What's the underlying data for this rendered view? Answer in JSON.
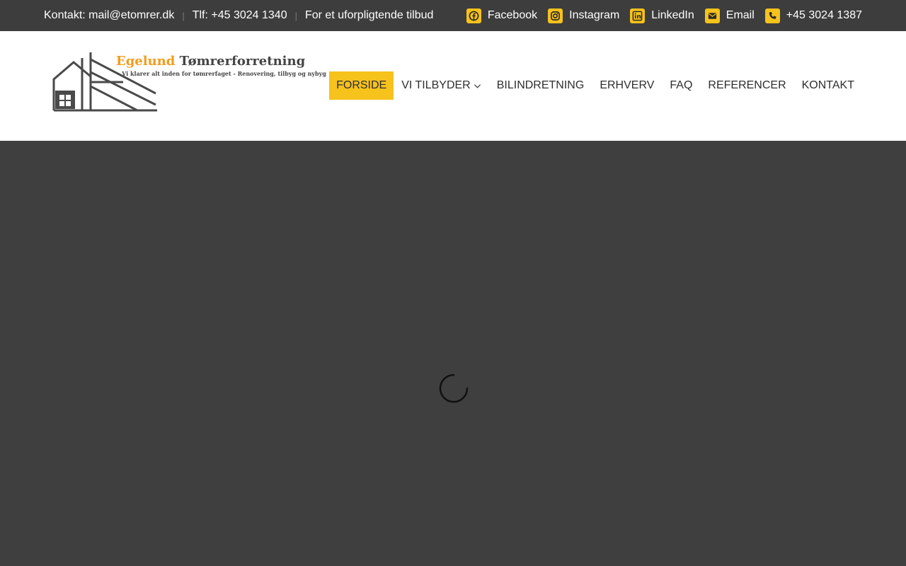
{
  "topbar": {
    "contact_email": "Kontakt: mail@etomrer.dk",
    "phone": "Tlf: +45 3024 1340",
    "offer": "For et uforpligtende tilbud",
    "separator": "|",
    "links": [
      {
        "label": "Facebook",
        "icon": "facebook-icon"
      },
      {
        "label": "Instagram",
        "icon": "instagram-icon"
      },
      {
        "label": "LinkedIn",
        "icon": "linkedin-icon"
      },
      {
        "label": "Email",
        "icon": "email-icon"
      },
      {
        "label": "+45 3024 1387",
        "icon": "phone-icon"
      }
    ]
  },
  "logo": {
    "name_part1": "Egelund ",
    "name_part2": "Tømrerforretning",
    "tagline": "- Vi klarer alt inden for tømrerfaget - Renovering, tilbyg og nybyg"
  },
  "nav": {
    "items": [
      {
        "label": "Forside",
        "active": true
      },
      {
        "label": "Vi tilbyder",
        "dropdown": true
      },
      {
        "label": "Bilindretning"
      },
      {
        "label": "Erhverv"
      },
      {
        "label": "FAQ"
      },
      {
        "label": "Referencer"
      },
      {
        "label": "Kontakt"
      }
    ]
  },
  "colors": {
    "accent": "#f6c21c",
    "topbar_bg": "#3d3d3d",
    "body_bg": "#3f3f3f"
  }
}
